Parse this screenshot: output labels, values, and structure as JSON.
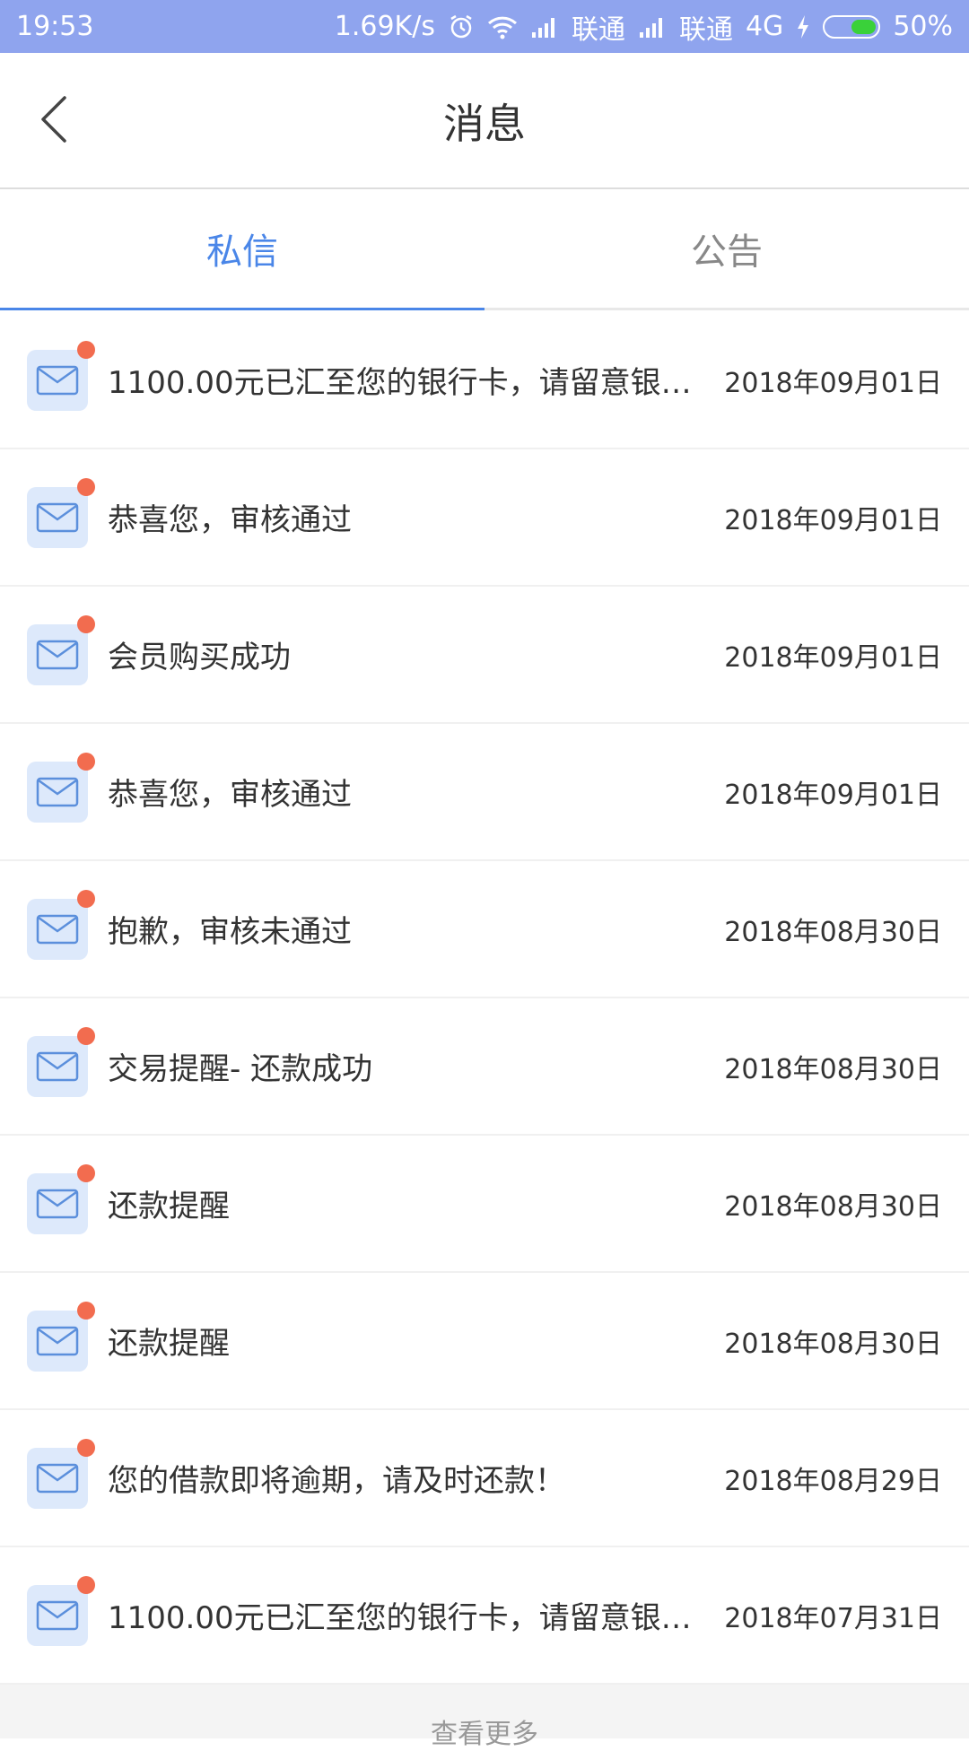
{
  "status_bar": {
    "time": "19:53",
    "net_speed": "1.69K/s",
    "carrier1": "联通",
    "carrier2": "联通",
    "network_type": "4G",
    "battery": "50%",
    "battery_level": 0.5,
    "icons": [
      "alarm-icon",
      "wifi-icon",
      "signal-icon",
      "charging-icon",
      "battery-icon"
    ]
  },
  "header": {
    "title": "消息",
    "back_icon": "chevron-left-icon"
  },
  "tabs": [
    {
      "label": "私信",
      "active": true
    },
    {
      "label": "公告",
      "active": false
    }
  ],
  "messages": [
    {
      "text": "1100.00元已汇至您的银行卡，请留意银行…",
      "date": "2018年09月01日",
      "unread": true
    },
    {
      "text": "恭喜您，审核通过",
      "date": "2018年09月01日",
      "unread": true
    },
    {
      "text": "会员购买成功",
      "date": "2018年09月01日",
      "unread": true
    },
    {
      "text": "恭喜您，审核通过",
      "date": "2018年09月01日",
      "unread": true
    },
    {
      "text": "抱歉，审核未通过",
      "date": "2018年08月30日",
      "unread": true
    },
    {
      "text": "交易提醒- 还款成功",
      "date": "2018年08月30日",
      "unread": true
    },
    {
      "text": "还款提醒",
      "date": "2018年08月30日",
      "unread": true
    },
    {
      "text": "还款提醒",
      "date": "2018年08月30日",
      "unread": true
    },
    {
      "text": "您的借款即将逾期，请及时还款！",
      "date": "2018年08月29日",
      "unread": true
    },
    {
      "text": "1100.00元已汇至您的银行卡，请留意银行…",
      "date": "2018年07月31日",
      "unread": true
    }
  ],
  "load_more": {
    "label": "查看更多"
  },
  "colors": {
    "status_bar": "#8fa4ee",
    "accent": "#4a86e8",
    "unread_dot": "#f26c4f",
    "icon_bg": "#dde9fb"
  }
}
